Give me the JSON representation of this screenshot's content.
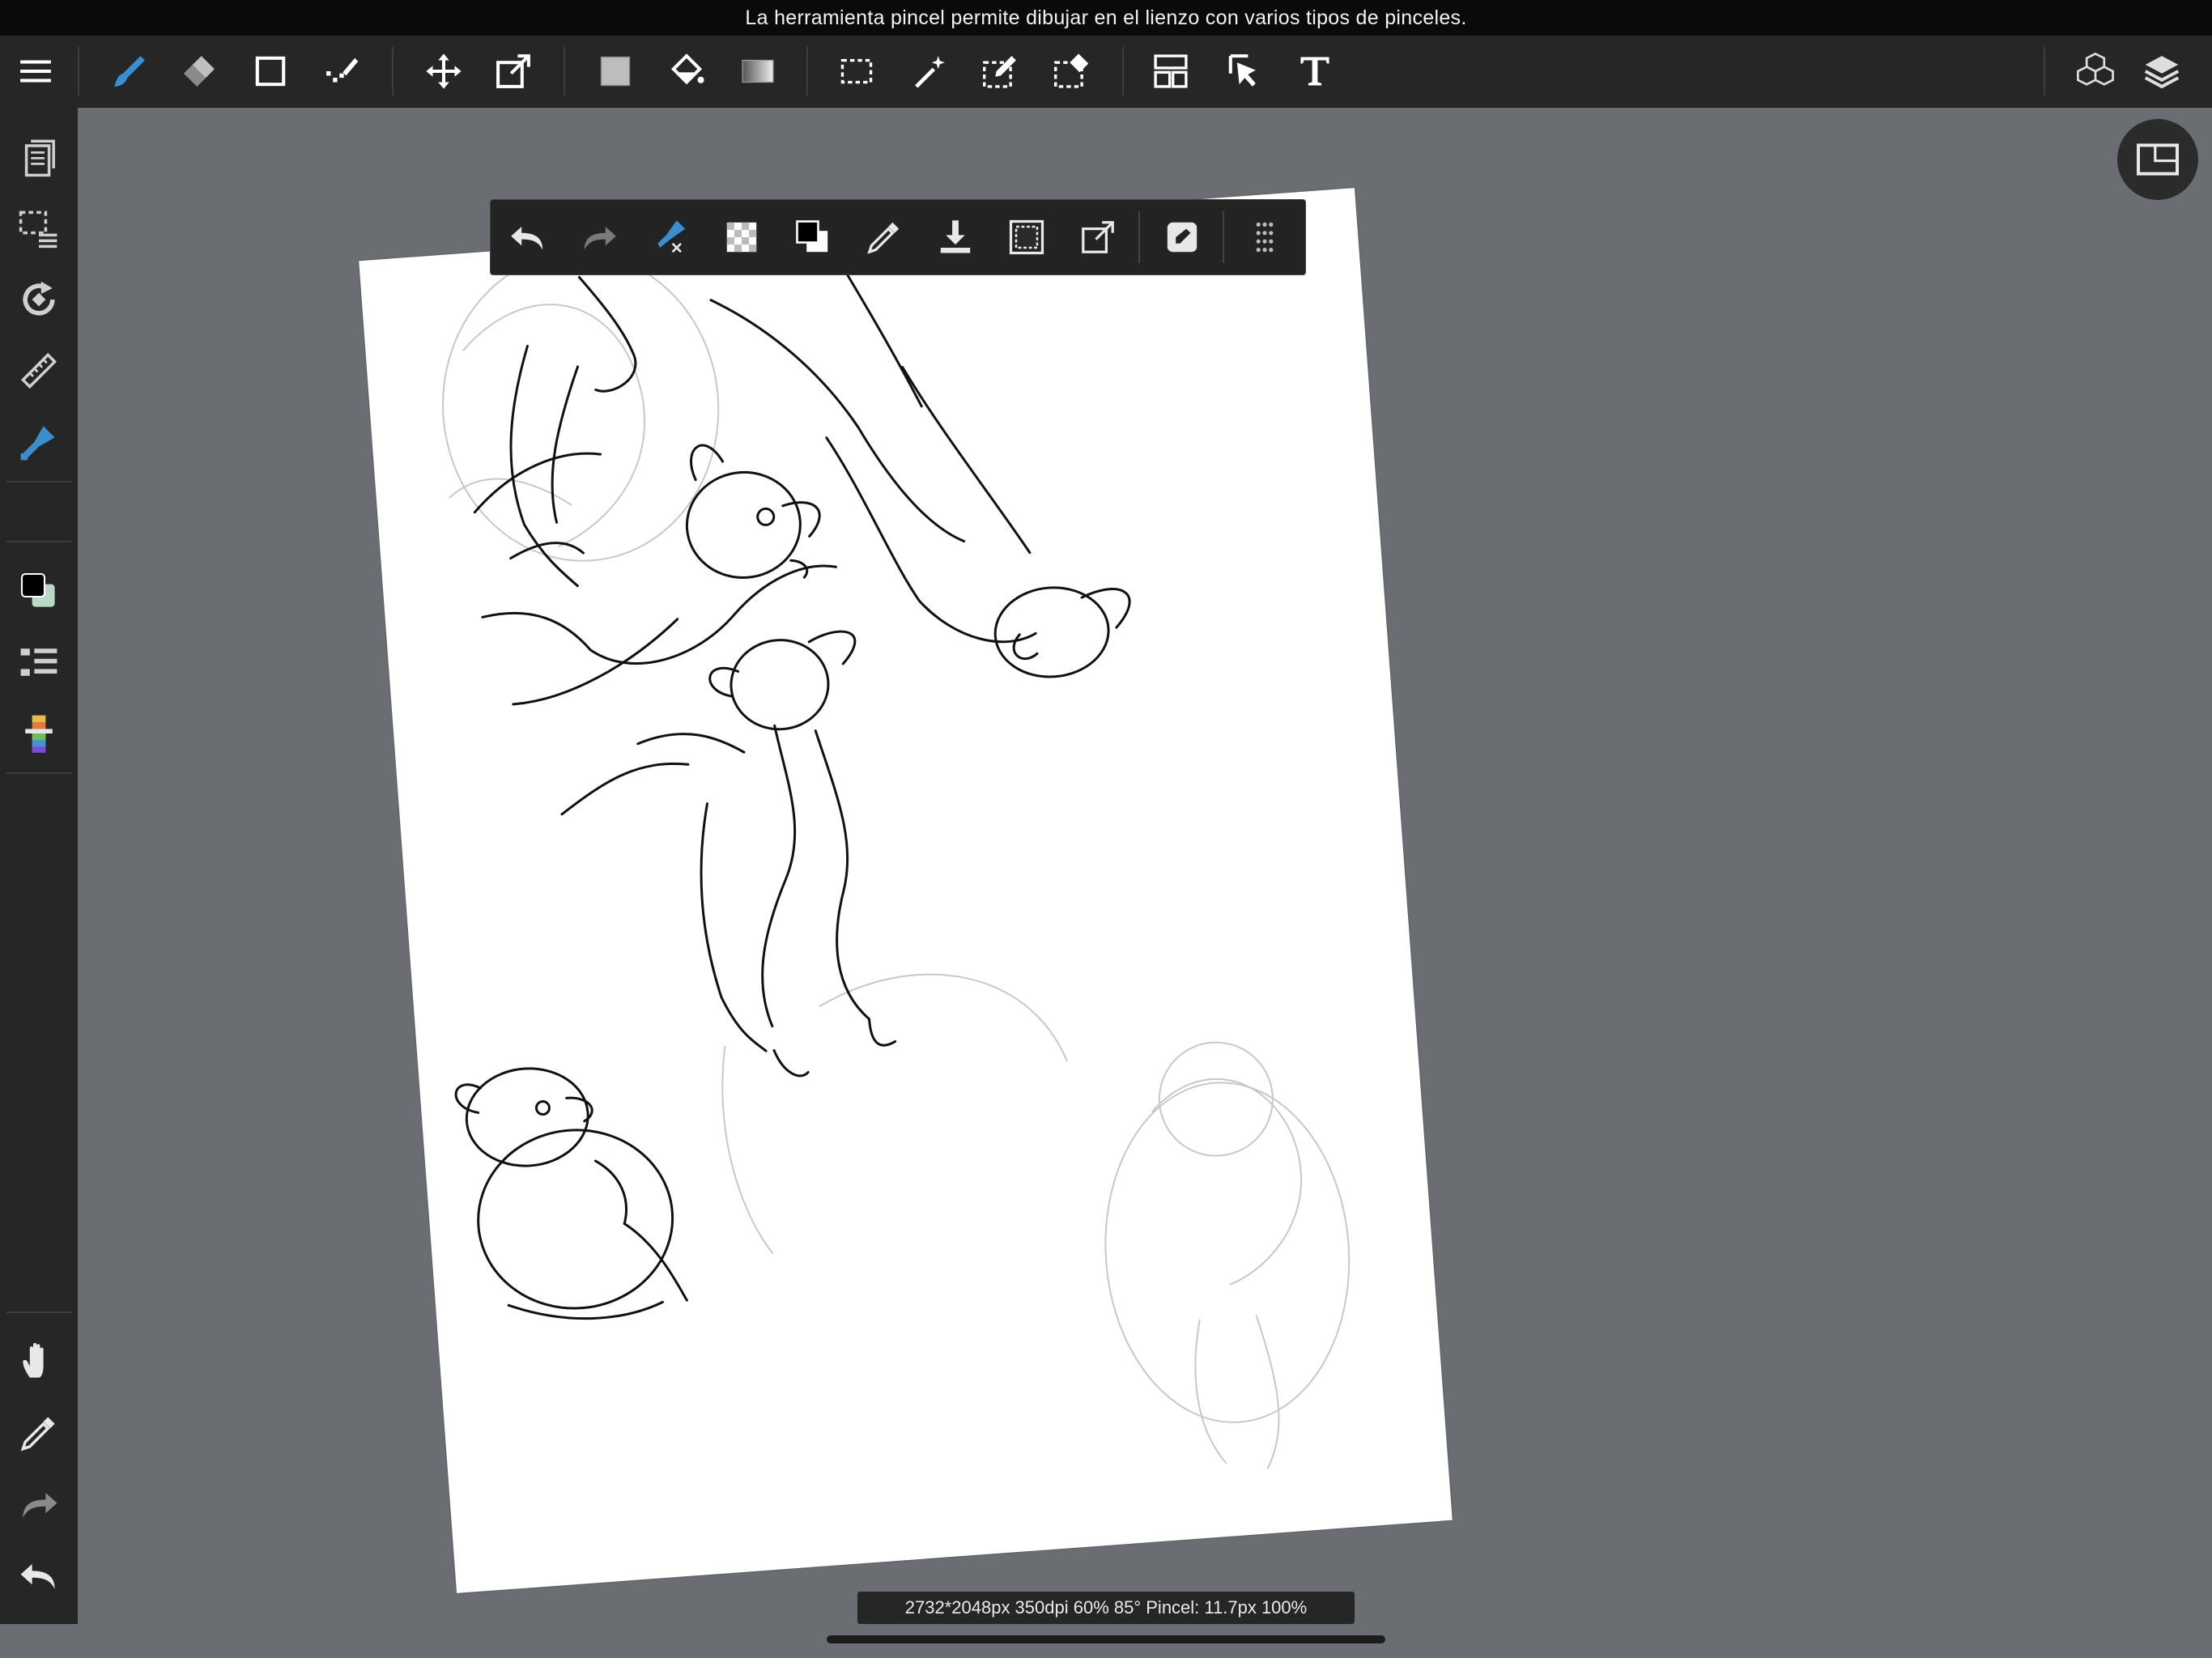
{
  "hint_text": "La herramienta pincel permite dibujar en el lienzo con varios tipos de pinceles.",
  "status_text": "2732*2048px 350dpi 60% 85° Pincel: 11.7px 100%",
  "colors": {
    "accent": "#3a8fd0",
    "toolbar_bg": "#262626",
    "canvas_bg": "#6a6d72",
    "paper": "#ffffff",
    "main_color": "#000000",
    "sub_color": "#b8d8c8"
  },
  "top_toolbar": {
    "items": [
      {
        "name": "menu-icon",
        "active": false
      },
      {
        "name": "brush-icon",
        "active": true
      },
      {
        "name": "eraser-icon",
        "active": false
      },
      {
        "name": "shape-icon",
        "active": false
      },
      {
        "name": "dot-brush-icon",
        "active": false
      },
      {
        "name": "move-icon",
        "active": false
      },
      {
        "name": "transform-icon",
        "active": false
      },
      {
        "name": "fill-color-icon",
        "active": false
      },
      {
        "name": "bucket-icon",
        "active": false
      },
      {
        "name": "gradient-icon",
        "active": false
      },
      {
        "name": "selection-icon",
        "active": false
      },
      {
        "name": "magic-wand-icon",
        "active": false
      },
      {
        "name": "select-pen-icon",
        "active": false
      },
      {
        "name": "select-eraser-icon",
        "active": false
      },
      {
        "name": "frame-divider-icon",
        "active": false
      },
      {
        "name": "operation-icon",
        "active": false
      },
      {
        "name": "text-icon",
        "active": false
      },
      {
        "name": "materials-icon",
        "active": false
      },
      {
        "name": "layers-icon",
        "active": false
      }
    ]
  },
  "left_toolbar": {
    "items": [
      {
        "name": "pages-icon"
      },
      {
        "name": "select-layer-icon"
      },
      {
        "name": "rotate-icon"
      },
      {
        "name": "ruler-icon"
      },
      {
        "name": "brush-settings-icon"
      },
      {
        "name": "color-swatch-icon"
      },
      {
        "name": "brush-list-icon"
      },
      {
        "name": "color-palette-icon"
      },
      {
        "name": "hand-icon"
      },
      {
        "name": "eyedropper-icon"
      },
      {
        "name": "redo-icon"
      },
      {
        "name": "undo-icon"
      }
    ]
  },
  "floating_toolbar": {
    "items": [
      {
        "name": "undo-icon"
      },
      {
        "name": "redo-icon"
      },
      {
        "name": "brush-tool-icon"
      },
      {
        "name": "transparent-icon"
      },
      {
        "name": "color-switch-icon"
      },
      {
        "name": "eyedropper-icon"
      },
      {
        "name": "import-icon"
      },
      {
        "name": "invert-selection-icon"
      },
      {
        "name": "transform-icon"
      },
      {
        "name": "edit-icon"
      },
      {
        "name": "handle-icon"
      }
    ]
  }
}
